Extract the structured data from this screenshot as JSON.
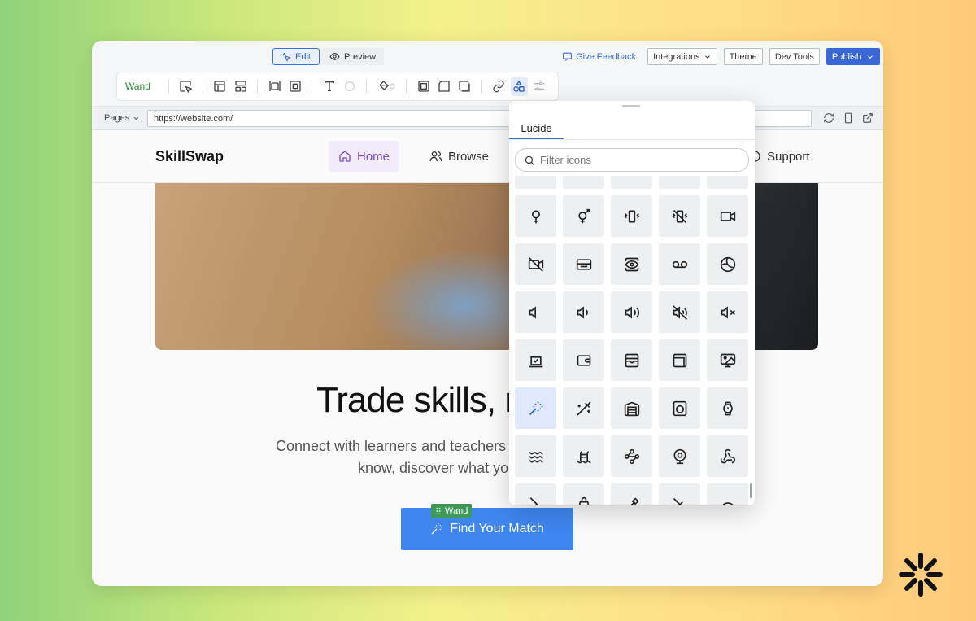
{
  "topbar": {
    "modes": [
      {
        "label": "Edit",
        "active": true
      },
      {
        "label": "Preview",
        "active": false
      }
    ],
    "feedback": "Give Feedback",
    "integrations": "Integrations",
    "theme": "Theme",
    "devtools": "Dev Tools",
    "publish": "Publish"
  },
  "toolbar": {
    "label": "Wand"
  },
  "addressbar": {
    "pages": "Pages",
    "url": "https://website.com/"
  },
  "site": {
    "brand": "SkillSwap",
    "nav": [
      "Home",
      "Browse",
      "Support"
    ],
    "hero_title": "Trade skills, n",
    "hero_sub_1": "Connect with learners and teachers",
    "hero_sub_2": "know, discover what yo",
    "cta": "Find Your Match",
    "wand_tag": "Wand"
  },
  "icon_picker": {
    "tab": "Lucide",
    "search_placeholder": "Filter icons",
    "selected_icon": "wand-icon"
  },
  "colors": {
    "accent": "#3a67d8",
    "cta": "#3f86ef",
    "wand_tag": "#3f9a5a",
    "nav_active": "#7a4bc8"
  }
}
